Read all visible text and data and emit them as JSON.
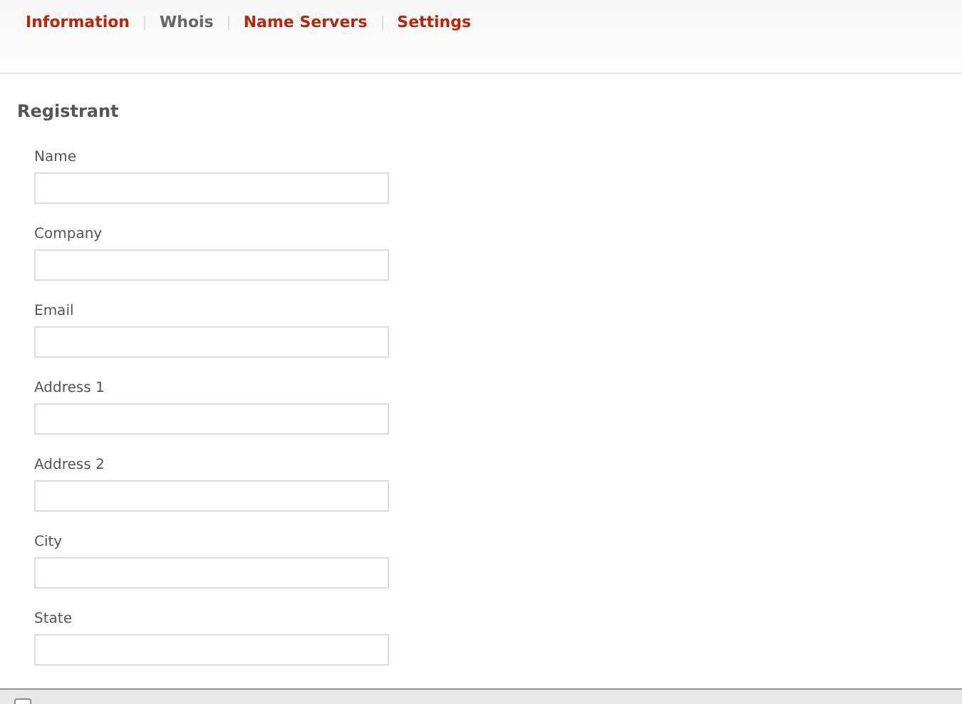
{
  "tabs": [
    {
      "label": "Information",
      "selected": false
    },
    {
      "label": "Whois",
      "selected": true
    },
    {
      "label": "Name Servers",
      "selected": false
    },
    {
      "label": "Settings",
      "selected": false
    }
  ],
  "section": {
    "title": "Registrant",
    "fields": [
      {
        "label": "Name"
      },
      {
        "label": "Company"
      },
      {
        "label": "Email"
      },
      {
        "label": "Address 1"
      },
      {
        "label": "Address 2"
      },
      {
        "label": "City"
      },
      {
        "label": "State"
      }
    ]
  },
  "footer": {
    "checkbox": {
      "checked": false
    }
  }
}
